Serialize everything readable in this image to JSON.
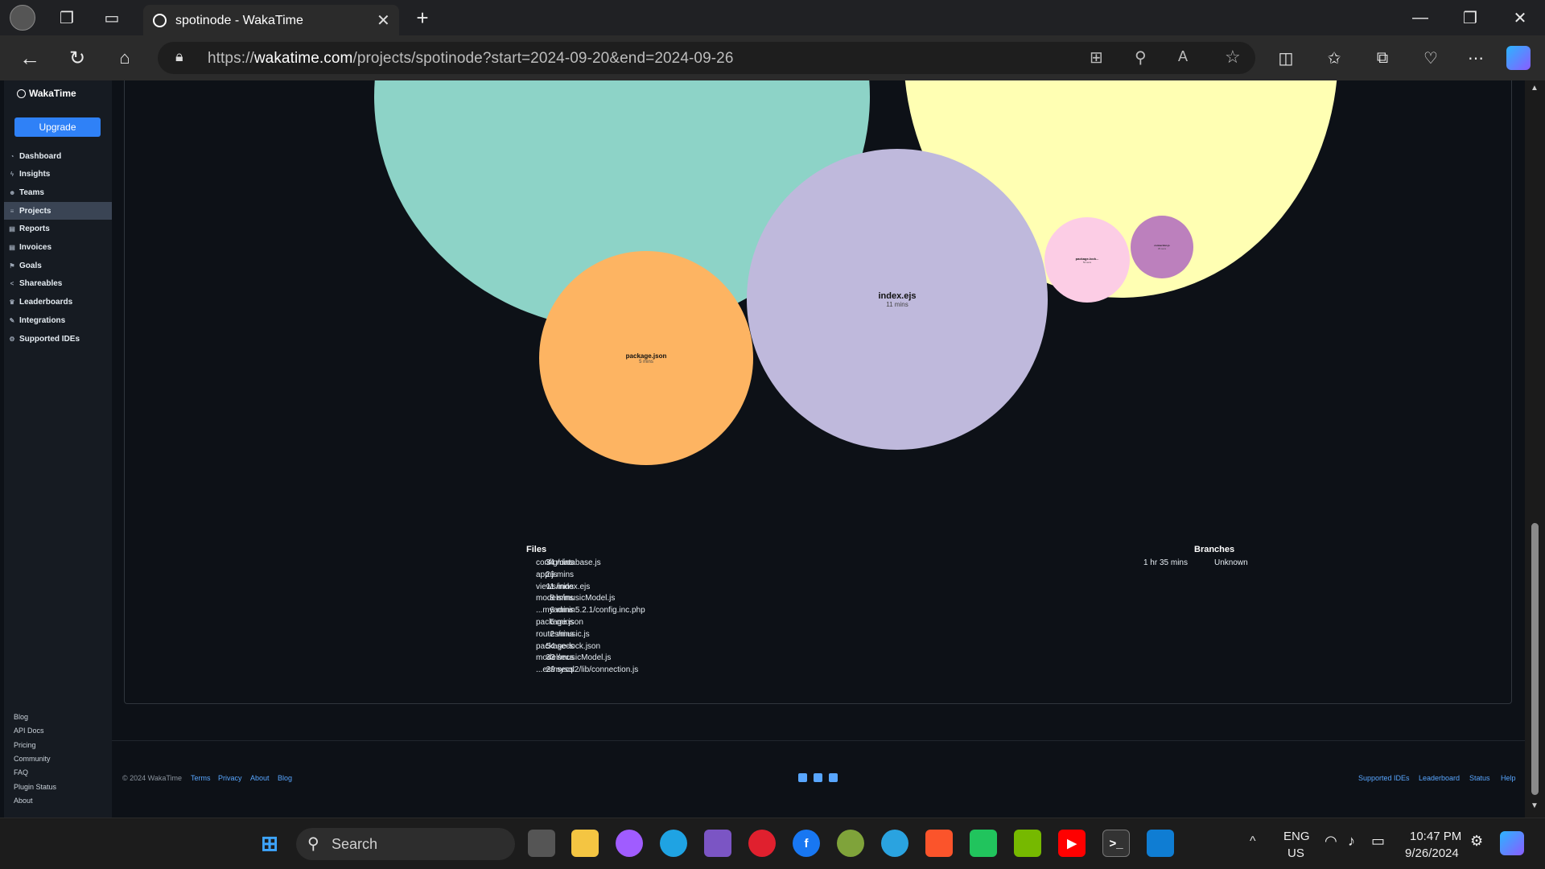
{
  "browser": {
    "tab_title": "spotinode - WakaTime",
    "url_prefix": "https://",
    "url_host": "wakatime.com",
    "url_path": "/projects/spotinode?start=2024-09-20&end=2024-09-26"
  },
  "sidebar": {
    "brand": "WakaTime",
    "upgrade_label": "Upgrade",
    "items": [
      {
        "label": "Dashboard",
        "icon": "dashboard-icon"
      },
      {
        "label": "Insights",
        "icon": "bolt-icon"
      },
      {
        "label": "Teams",
        "icon": "users-icon"
      },
      {
        "label": "Projects",
        "icon": "list-icon",
        "active": true
      },
      {
        "label": "Reports",
        "icon": "document-icon"
      },
      {
        "label": "Invoices",
        "icon": "invoice-icon"
      },
      {
        "label": "Goals",
        "icon": "flag-icon"
      },
      {
        "label": "Shareables",
        "icon": "share-icon"
      },
      {
        "label": "Leaderboards",
        "icon": "trophy-icon"
      },
      {
        "label": "Integrations",
        "icon": "wrench-icon"
      },
      {
        "label": "Supported IDEs",
        "icon": "gear-icon"
      }
    ],
    "footer_links": [
      "Blog",
      "API Docs",
      "Pricing",
      "Community",
      "FAQ",
      "Plugin Status",
      "About"
    ]
  },
  "bubbles": [
    {
      "name": "index.ejs",
      "time": "11 mins",
      "color": "#bfb9dc"
    },
    {
      "name": "package.json",
      "time": "5 mins",
      "color": "#fdb462"
    },
    {
      "name": "package-lock...",
      "time": "54 secs",
      "color": "#fccde5"
    },
    {
      "name": "connection.js",
      "time": "29 secs",
      "color": "#bc80bd"
    },
    {
      "name": "",
      "time": "",
      "color": "#8dd3c7"
    },
    {
      "name": "",
      "time": "",
      "color": "#ffffb3"
    }
  ],
  "files": {
    "title": "Files",
    "rows": [
      {
        "time": "34 mins",
        "name": "config/database.js"
      },
      {
        "time": "26 mins",
        "name": "app.js"
      },
      {
        "time": "11 mins",
        "name": "views/index.ejs"
      },
      {
        "time": "8 mins",
        "name": "models/musicModel.js"
      },
      {
        "time": "6 mins",
        "name": "...myadmin5.2.1/config.inc.php"
      },
      {
        "time": "5 mins",
        "name": "package.json"
      },
      {
        "time": "2 mins",
        "name": "routes/music.js"
      },
      {
        "time": "54 secs",
        "name": "package-lock.json"
      },
      {
        "time": "33 secs",
        "name": "model/musicModel.js"
      },
      {
        "time": "29 secs",
        "name": "...es/mysql2/lib/connection.js"
      }
    ]
  },
  "branches": {
    "title": "Branches",
    "rows": [
      {
        "time": "1 hr 35 mins",
        "name": "Unknown"
      }
    ]
  },
  "page_footer": {
    "copyright": "© 2024 WakaTime",
    "left_links": [
      "Terms",
      "Privacy",
      "About",
      "Blog"
    ],
    "right_links": [
      "Supported IDEs",
      "Leaderboard",
      "Status",
      "Help"
    ]
  },
  "taskbar": {
    "search_placeholder": "Search",
    "lang_top": "ENG",
    "lang_bottom": "US",
    "time": "10:47 PM",
    "date": "9/26/2024"
  }
}
